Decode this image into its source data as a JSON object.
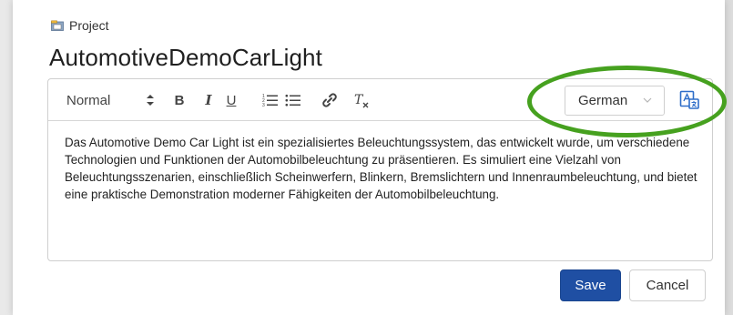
{
  "breadcrumb": {
    "icon": "project-icon",
    "label": "Project"
  },
  "title": "AutomotiveDemoCarLight",
  "toolbar": {
    "format_label": "Normal",
    "bold_label": "B",
    "italic_label": "I",
    "underline_label": "U",
    "clear_label": "T"
  },
  "language": {
    "selected": "German"
  },
  "content": "Das Automotive Demo Car Light ist ein spezialisiertes Beleuchtungssystem, das entwickelt wurde, um verschiedene Technologien und Funktionen der Automobilbeleuchtung zu präsentieren. Es simuliert eine Vielzahl von Beleuchtungsszenarien, einschließlich Scheinwerfern, Blinkern, Bremslichtern und Innenraumbeleuchtung, und bietet eine praktische Demonstration moderner Fähigkeiten der Automobilbeleuchtung.",
  "actions": {
    "save_label": "Save",
    "cancel_label": "Cancel"
  },
  "colors": {
    "primary": "#1f4fa3",
    "highlight": "#46a11f"
  }
}
